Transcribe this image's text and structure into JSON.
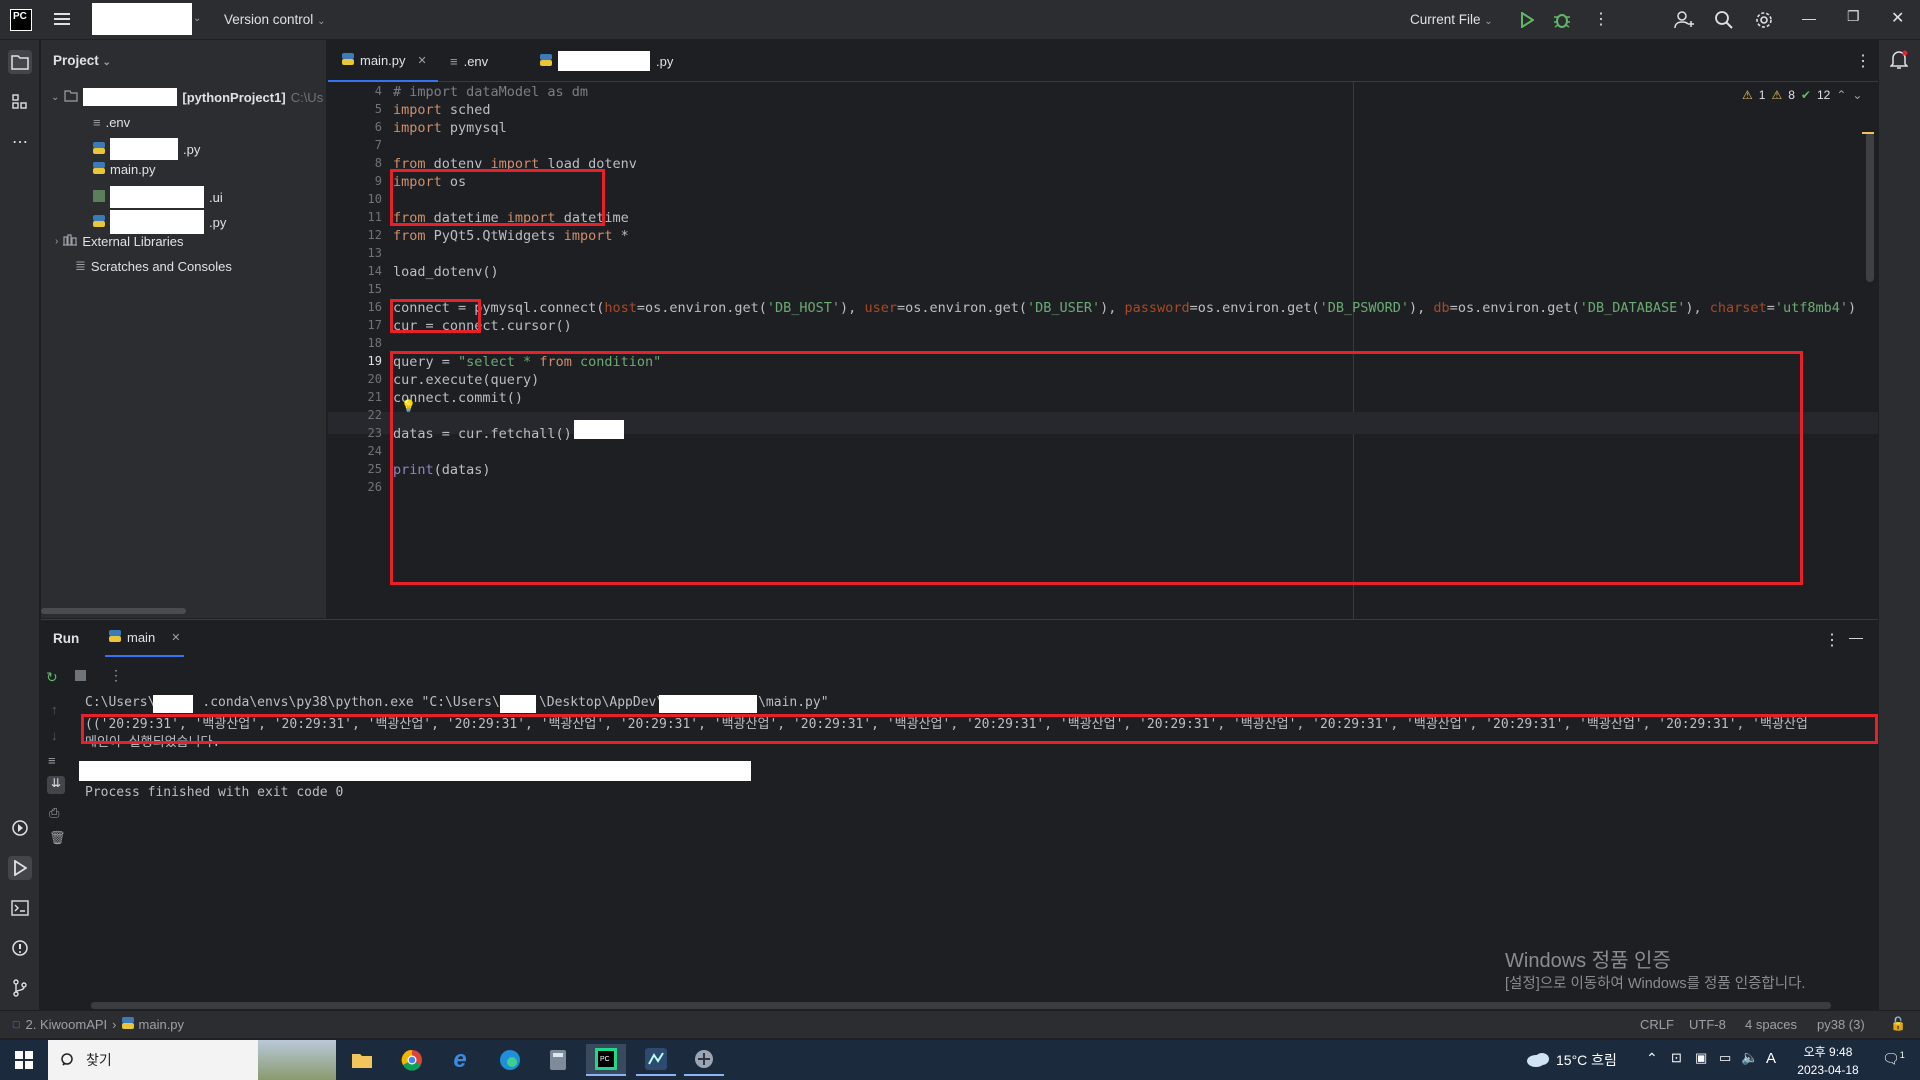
{
  "titlebar": {
    "app_logo": "PC",
    "project_name": "",
    "version_control": "Version control",
    "run_config": "Current File"
  },
  "project_panel": {
    "title": "Project",
    "root_suffix": "[pythonProject1]",
    "root_path": "C:\\Us",
    "files": [
      ".env",
      ".py",
      "main.py",
      ".ui",
      ".py"
    ],
    "external_libraries": "External Libraries",
    "scratches": "Scratches and Consoles"
  },
  "editor": {
    "tabs": [
      "main.py",
      ".env",
      ".py"
    ],
    "inspections": {
      "warnings": "1",
      "weak_warnings": "8",
      "ok": "12"
    },
    "lines": [
      {
        "n": "4",
        "text": "# import dataModel as dm"
      },
      {
        "n": "5",
        "text": "import sched"
      },
      {
        "n": "6",
        "text": "import pymysql"
      },
      {
        "n": "7",
        "text": ""
      },
      {
        "n": "8",
        "text": "from dotenv import load_dotenv"
      },
      {
        "n": "9",
        "text": "import os"
      },
      {
        "n": "10",
        "text": ""
      },
      {
        "n": "11",
        "text": "from datetime import datetime"
      },
      {
        "n": "12",
        "text": "from PyQt5.QtWidgets import *"
      },
      {
        "n": "13",
        "text": ""
      },
      {
        "n": "14",
        "text": "load_dotenv()"
      },
      {
        "n": "15",
        "text": ""
      },
      {
        "n": "16",
        "text": "connect = pymysql.connect(host=os.environ.get('DB_HOST'), user=os.environ.get('DB_USER'), password=os.environ.get('DB_PSWORD'), db=os.environ.get('DB_DATABASE'), charset='utf8mb4')"
      },
      {
        "n": "17",
        "text": "cur = connect.cursor()"
      },
      {
        "n": "18",
        "text": ""
      },
      {
        "n": "19",
        "text": "query = \"select * from condition\""
      },
      {
        "n": "20",
        "text": "cur.execute(query)"
      },
      {
        "n": "21",
        "text": "connect.commit()"
      },
      {
        "n": "22",
        "text": ""
      },
      {
        "n": "23",
        "text": "datas = cur.fetchall()"
      },
      {
        "n": "24",
        "text": ""
      },
      {
        "n": "25",
        "text": "print(datas)"
      },
      {
        "n": "26",
        "text": ""
      }
    ]
  },
  "run_panel": {
    "title": "Run",
    "tab": "main",
    "output": [
      "C:\\Users\\      .conda\\envs\\py38\\python.exe \"C:\\Users\\     \\Desktop\\AppDev\\            \\main.py\"",
      "(('20:29:31', '백광산업', '20:29:31', '백광산업', '20:29:31', '백광산업', '20:29:31', '백광산업', '20:29:31', '백광산업', '20:29:31', '백광산업', '20:29:31', '백광산업', '20:29:31', '백광산업', '20:29:31', '백광산업', '20:29:31', '백광산업",
      "메인이 실행되었습니다.",
      "",
      "",
      "Process finished with exit code 0"
    ]
  },
  "watermark": {
    "line1": "Windows 정품 인증",
    "line2": "[설정]으로 이동하여 Windows를 정품 인증합니다."
  },
  "statusbar": {
    "breadcrumb_project": "2. KiwoomAPI",
    "breadcrumb_file": "main.py",
    "line_sep": "CRLF",
    "encoding": "UTF-8",
    "indent": "4 spaces",
    "interpreter": "py38 (3)"
  },
  "taskbar": {
    "search_placeholder": "찾기",
    "weather": "15°C 흐림",
    "time": "오후 9:48",
    "date": "2023-04-18",
    "notification_count": "1",
    "ime": "A"
  }
}
